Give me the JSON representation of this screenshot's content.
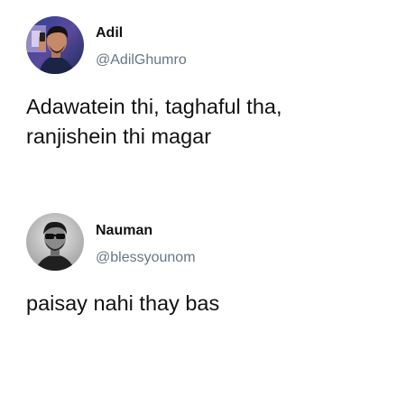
{
  "tweets": [
    {
      "author_name": "Adil",
      "author_handle": "@AdilGhumro",
      "avatar_icon": "user-photo-avatar",
      "text_lines": [
        "Adawatein thi, taghaful tha,",
        "ranjishein thi magar"
      ]
    },
    {
      "author_name": "Nauman",
      "author_handle": "@blessyounom",
      "avatar_icon": "user-photo-avatar",
      "text_lines": [
        "paisay nahi thay bas"
      ]
    }
  ],
  "colors": {
    "text": "#111111",
    "handle": "#657786",
    "background": "#ffffff"
  }
}
